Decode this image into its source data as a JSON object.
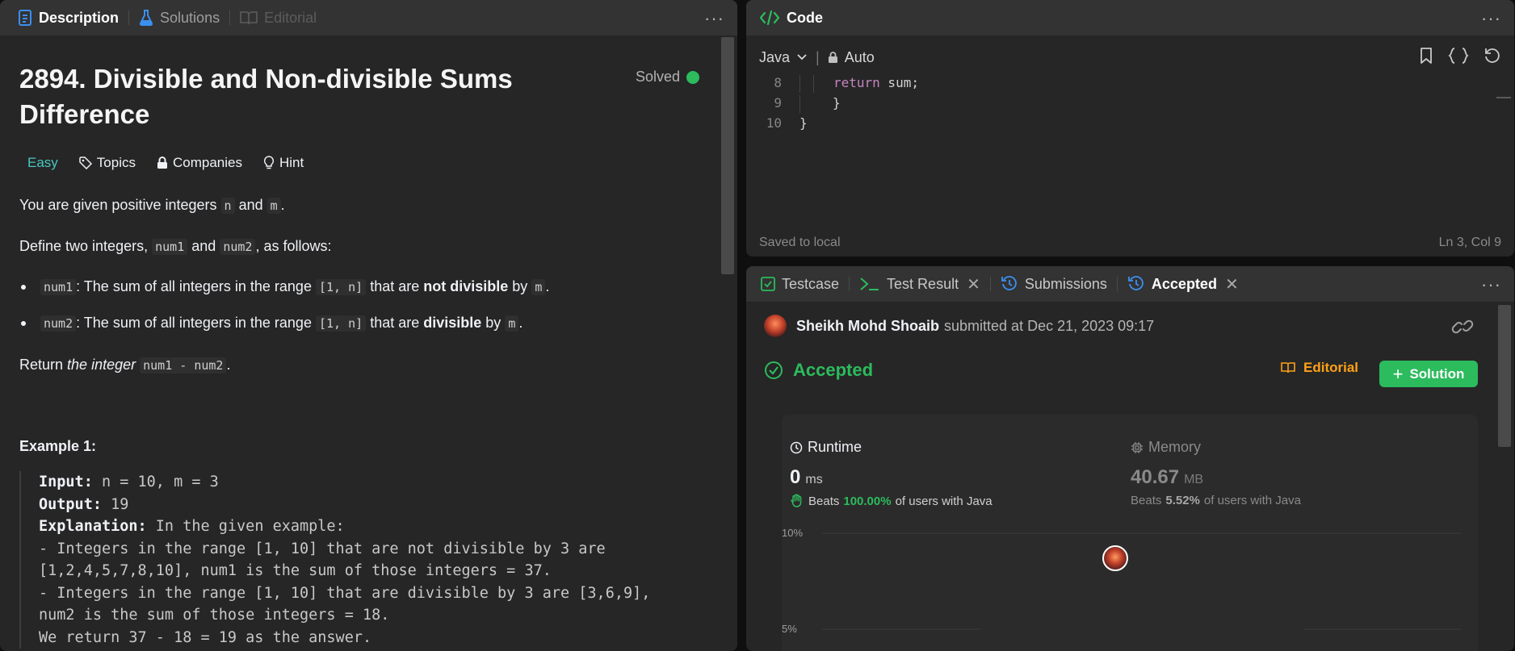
{
  "left_panel": {
    "tabs": [
      {
        "label": "Description",
        "icon": "description-icon",
        "active": true
      },
      {
        "label": "Solutions",
        "icon": "flask-icon",
        "active": false
      },
      {
        "label": "Editorial",
        "icon": "book-icon",
        "active": false,
        "disabled": true
      }
    ],
    "title": "2894. Divisible and Non-divisible Sums Difference",
    "solved_label": "Solved",
    "chips": {
      "difficulty": "Easy",
      "topics": "Topics",
      "companies": "Companies",
      "hint": "Hint"
    },
    "intro": {
      "t1": "You are given positive integers",
      "n": "n",
      "and": "and",
      "m": "m",
      "end": "."
    },
    "define": {
      "t1": "Define two integers,",
      "num1": "num1",
      "and": "and",
      "num2": "num2",
      "t2": ", as follows:"
    },
    "bullets": [
      {
        "var": "num1",
        "t1": ": The sum of all integers in the range",
        "range": "[1, n]",
        "t2": "that are",
        "bold": "not divisible",
        "t3": "by",
        "m": "m",
        "end": "."
      },
      {
        "var": "num2",
        "t1": ": The sum of all integers in the range",
        "range": "[1, n]",
        "t2": "that are",
        "bold": "divisible",
        "t3": "by",
        "m": "m",
        "end": "."
      }
    ],
    "return_line": {
      "t1": "Return",
      "em": "the integer",
      "code": "num1 - num2",
      "end": "."
    },
    "example_title": "Example 1:",
    "example": {
      "input_key": "Input:",
      "input_val": "n = 10, m = 3",
      "output_key": "Output:",
      "output_val": "19",
      "explanation_key": "Explanation:",
      "explanation_val": "In the given example:",
      "lines": [
        "- Integers in the range [1, 10] that are not divisible by 3 are",
        "[1,2,4,5,7,8,10], num1 is the sum of those integers = 37.",
        "- Integers in the range [1, 10] that are divisible by 3 are [3,6,9],",
        "num2 is the sum of those integers = 18.",
        "We return 37 - 18 = 19 as the answer."
      ]
    }
  },
  "code_panel": {
    "title": "Code",
    "language": "Java",
    "mode": "Auto",
    "lines": [
      {
        "no": "8",
        "keyword": "return",
        "rest": " sum;",
        "indent": 2
      },
      {
        "no": "9",
        "text": "}",
        "indent": 1
      },
      {
        "no": "10",
        "text": "}",
        "indent": 0
      }
    ],
    "status_left": "Saved to local",
    "status_right": "Ln 3, Col 9"
  },
  "result_panel": {
    "tabs": [
      {
        "label": "Testcase",
        "icon": "checkbox-icon"
      },
      {
        "label": "Test Result",
        "icon": "terminal-icon",
        "closable": true
      },
      {
        "label": "Submissions",
        "icon": "history-icon"
      },
      {
        "label": "Accepted",
        "icon": "history-icon",
        "closable": true,
        "active": true
      }
    ],
    "submitter_name": "Sheikh Mohd Shoaib",
    "submitted_text": "submitted at Dec 21, 2023 09:17",
    "status": "Accepted",
    "editorial_label": "Editorial",
    "solution_label": "Solution",
    "runtime": {
      "label": "Runtime",
      "value": "0",
      "unit": "ms",
      "beats_prefix": "Beats",
      "beats_pct": "100.00%",
      "beats_suffix": "of users with Java"
    },
    "memory": {
      "label": "Memory",
      "value": "40.67",
      "unit": "MB",
      "beats_prefix": "Beats",
      "beats_pct": "5.52%",
      "beats_suffix": "of users with Java"
    },
    "chart_data": {
      "type": "bar",
      "y_ticks": [
        "10%",
        "5%"
      ],
      "grid": true
    }
  },
  "colors": {
    "accent_green": "#2cbb5d",
    "easy_teal": "#46c6c2",
    "editorial_orange": "#ffa116",
    "panel_bg": "#262626",
    "tabbar_bg": "#333333"
  }
}
